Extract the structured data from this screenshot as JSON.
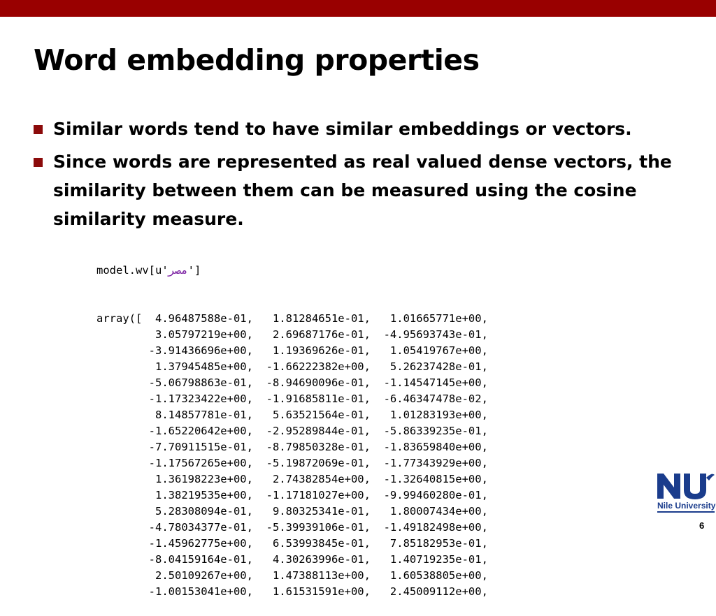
{
  "colors": {
    "top_bar": "#990000",
    "bullet_marker": "#8b0a0a",
    "logo_blue": "#1a3c8c",
    "arabic_text": "#7a1fa2"
  },
  "slide": {
    "title": "Word embedding properties",
    "bullets": [
      "Similar words tend to have similar embeddings or vectors.",
      "Since words are represented as real valued dense vectors, the similarity between them can be measured using the cosine similarity measure."
    ],
    "code": {
      "call_prefix": "model.wv[u'",
      "call_token": "مصر",
      "call_suffix": "']",
      "lines": [
        "array([  4.96487588e-01,   1.81284651e-01,   1.01665771e+00,",
        "         3.05797219e+00,   2.69687176e-01,  -4.95693743e-01,",
        "        -3.91436696e+00,   1.19369626e-01,   1.05419767e+00,",
        "         1.37945485e+00,  -1.66222382e+00,   5.26237428e-01,",
        "        -5.06798863e-01,  -8.94690096e-01,  -1.14547145e+00,",
        "        -1.17323422e+00,  -1.91685811e-01,  -6.46347478e-02,",
        "         8.14857781e-01,   5.63521564e-01,   1.01283193e+00,",
        "        -1.65220642e+00,  -2.95289844e-01,  -5.86339235e-01,",
        "        -7.70911515e-01,  -8.79850328e-01,  -1.83659840e+00,",
        "        -1.17567265e+00,  -5.19872069e-01,  -1.77343929e+00,",
        "         1.36198223e+00,   2.74382854e+00,  -1.32640815e+00,",
        "         1.38219535e+00,  -1.17181027e+00,  -9.99460280e-01,",
        "         5.28308094e-01,   9.80325341e-01,   1.80007434e+00,",
        "        -4.78034377e-01,  -5.39939106e-01,  -1.49182498e+00,",
        "        -1.45962775e+00,   6.53993845e-01,   7.85182953e-01,",
        "        -8.04159164e-01,   4.30263996e-01,   1.40719235e-01,",
        "         2.50109267e+00,   1.47388113e+00,   1.60538805e+00,",
        "        -1.00153041e+00,   1.61531591e+00,   2.45009112e+00,"
      ]
    },
    "logo": {
      "text": "Nile University"
    },
    "page_number": "6"
  }
}
